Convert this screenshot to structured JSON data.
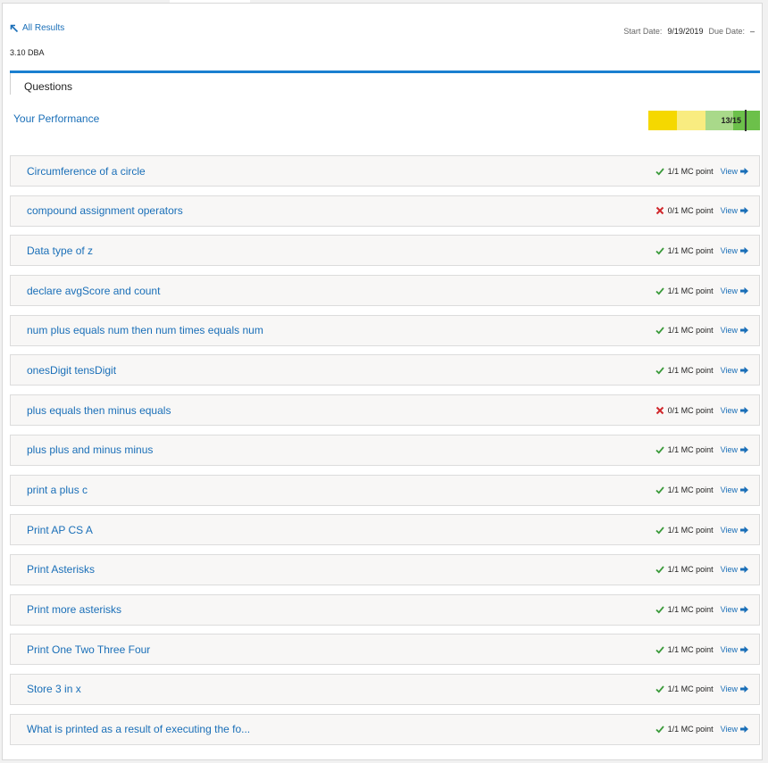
{
  "header": {
    "back_label": "All Results",
    "course": "3.10 DBA",
    "start_date_label": "Start Date:",
    "start_date_value": "9/19/2019",
    "due_date_label": "Due Date:",
    "due_date_value": "–"
  },
  "section_tab": "Questions",
  "performance": {
    "label": "Your Performance",
    "score_text": "13/15",
    "score_fraction": 0.8667,
    "band_colors": [
      "#f5d800",
      "#f9ec80",
      "#a9d98a",
      "#6cc04a"
    ]
  },
  "questions": [
    {
      "title": "Circumference of a circle",
      "status": "correct",
      "points": "1/1 MC point",
      "view": "View"
    },
    {
      "title": "compound assignment operators",
      "status": "incorrect",
      "points": "0/1 MC point",
      "view": "View"
    },
    {
      "title": "Data type of z",
      "status": "correct",
      "points": "1/1 MC point",
      "view": "View"
    },
    {
      "title": "declare avgScore and count",
      "status": "correct",
      "points": "1/1 MC point",
      "view": "View"
    },
    {
      "title": "num plus equals num then num times equals num",
      "status": "correct",
      "points": "1/1 MC point",
      "view": "View"
    },
    {
      "title": "onesDigit tensDigit",
      "status": "correct",
      "points": "1/1 MC point",
      "view": "View"
    },
    {
      "title": "plus equals then minus equals",
      "status": "incorrect",
      "points": "0/1 MC point",
      "view": "View"
    },
    {
      "title": "plus plus and minus minus",
      "status": "correct",
      "points": "1/1 MC point",
      "view": "View"
    },
    {
      "title": "print a plus c",
      "status": "correct",
      "points": "1/1 MC point",
      "view": "View"
    },
    {
      "title": "Print AP CS A",
      "status": "correct",
      "points": "1/1 MC point",
      "view": "View"
    },
    {
      "title": "Print Asterisks",
      "status": "correct",
      "points": "1/1 MC point",
      "view": "View"
    },
    {
      "title": "Print more asterisks",
      "status": "correct",
      "points": "1/1 MC point",
      "view": "View"
    },
    {
      "title": "Print One Two Three Four",
      "status": "correct",
      "points": "1/1 MC point",
      "view": "View"
    },
    {
      "title": "Store 3 in x",
      "status": "correct",
      "points": "1/1 MC point",
      "view": "View"
    },
    {
      "title": "What is printed as a result of executing the fo...",
      "status": "correct",
      "points": "1/1 MC point",
      "view": "View"
    }
  ],
  "colors": {
    "link_blue": "#1a6fb8",
    "rule_blue": "#1a7fd0",
    "correct_green": "#3a9a3a",
    "incorrect_red": "#d0282c"
  }
}
